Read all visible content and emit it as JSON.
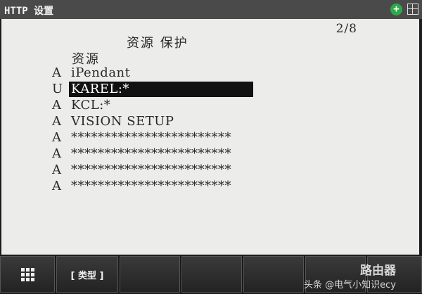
{
  "titlebar": {
    "title": "HTTP 设置",
    "zoom_icon": "zoom-in-icon",
    "layout_icon": "split-screen-icon"
  },
  "screen": {
    "page_indicator": "2/8",
    "heading": "资源 保护",
    "column_header": "资源",
    "rows": [
      {
        "status": "A",
        "name": "iPendant"
      },
      {
        "status": "U",
        "name": "KAREL:*",
        "selected": true
      },
      {
        "status": "A",
        "name": "KCL:*"
      },
      {
        "status": "A",
        "name": "VISION SETUP"
      },
      {
        "status": "A",
        "name": "************************"
      },
      {
        "status": "A",
        "name": "************************"
      },
      {
        "status": "A",
        "name": "************************"
      },
      {
        "status": "A",
        "name": "************************"
      }
    ]
  },
  "softkeys": {
    "menu_icon": "grid-menu-icon",
    "type_label": "[ 类型 ]"
  },
  "watermark": {
    "site": "路由器",
    "source": "头条 @电气小知识ecy"
  },
  "colors": {
    "screen_bg": "#ececea",
    "titlebar_bg": "#4a4a4a",
    "selection_bg": "#111111",
    "zoom_green": "#2fa84a"
  }
}
